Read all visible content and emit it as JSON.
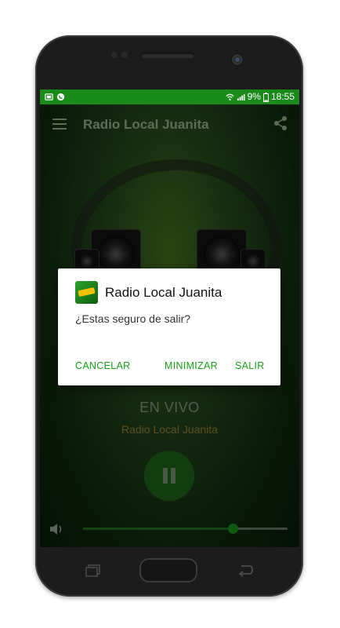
{
  "status_bar": {
    "battery": "9%",
    "time": "18:55",
    "left_icons": [
      "sim-toolkit-icon",
      "whatsapp-icon"
    ],
    "right_icons": [
      "wifi-icon",
      "signal-icon",
      "battery-icon"
    ]
  },
  "toolbar": {
    "title": "Radio Local Juanita",
    "menu_icon": "hamburger-menu-icon",
    "share_icon": "share-icon"
  },
  "player": {
    "live_label": "EN VIVO",
    "station_name": "Radio Local Juanita",
    "play_state_icon": "pause-icon",
    "volume_icon": "volume-icon",
    "volume_level": 0.73
  },
  "dialog": {
    "title": "Radio Local Juanita",
    "message": "¿Estas seguro de salir?",
    "buttons": {
      "cancel": "CANCELAR",
      "minimize": "MINIMIZAR",
      "exit": "SALIR"
    }
  },
  "nav": {
    "recent_icon": "recent-apps-icon",
    "home_icon": "home-button",
    "back_icon": "back-icon"
  },
  "colors": {
    "accent": "#1a8a1a",
    "button_text": "#17a017",
    "toolbar_text": "#8fa884"
  }
}
